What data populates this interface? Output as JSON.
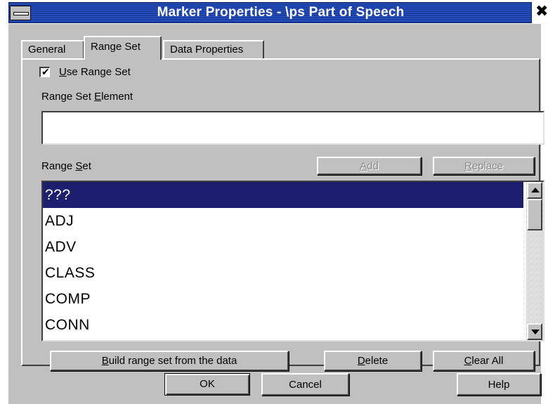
{
  "window": {
    "title": "Marker Properties - \\ps Part of Speech",
    "close_glyph": "✖"
  },
  "tabs": [
    {
      "label": "General",
      "active": false
    },
    {
      "label": "Range Set",
      "active": true
    },
    {
      "label": "Data Properties",
      "active": false
    }
  ],
  "range_tab": {
    "use_range_set": {
      "label_mnemonic": "U",
      "label_rest": "se Range Set",
      "checked": true,
      "check_glyph": "✔"
    },
    "element_label": {
      "before": "Range Set ",
      "mnemonic": "E",
      "after": "lement"
    },
    "element_value": "",
    "rangeset_label": {
      "before": "Range ",
      "mnemonic": "S",
      "after": "et"
    },
    "add_button": {
      "mnemonic": "A",
      "rest": "dd",
      "enabled": false
    },
    "replace_button": {
      "mnemonic": "R",
      "rest": "eplace",
      "enabled": false
    },
    "list_items": [
      "???",
      "ADJ",
      "ADV",
      "CLASS",
      "COMP",
      "CONN"
    ],
    "selected_index": 0,
    "build_button": {
      "mnemonic": "B",
      "rest": "uild range set from the data"
    },
    "delete_button": {
      "mnemonic": "D",
      "rest": "elete"
    },
    "clear_button": {
      "mnemonic": "C",
      "rest": "lear All"
    }
  },
  "footer": {
    "ok": "OK",
    "cancel": "Cancel",
    "help": "Help"
  },
  "colors": {
    "selection": "#1e1e6e",
    "face": "#c0c0c0",
    "titlebar": "#1a3ea0"
  }
}
